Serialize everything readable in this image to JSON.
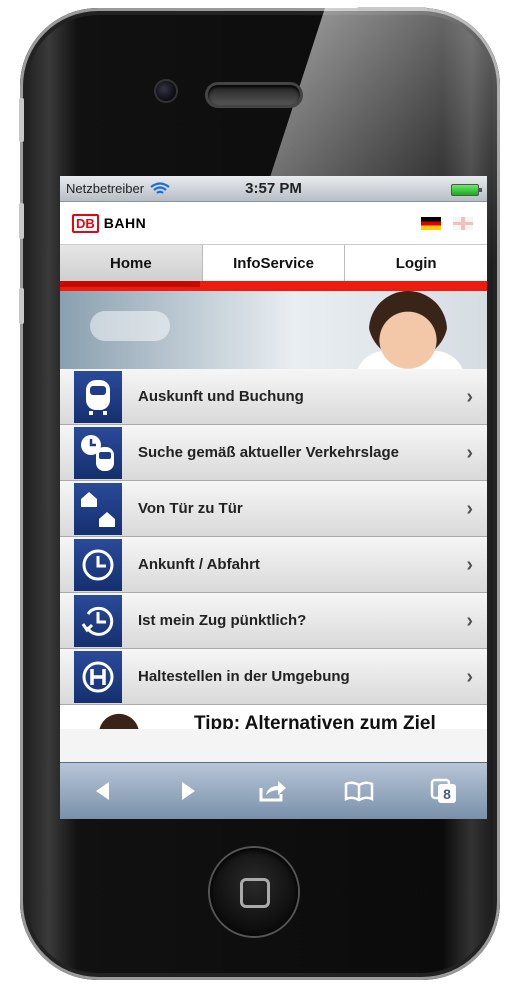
{
  "status_bar": {
    "carrier": "Netzbetreiber",
    "time": "3:57 PM"
  },
  "brand": {
    "logo_text": "DB",
    "name": "BAHN"
  },
  "tabs": [
    {
      "label": "Home"
    },
    {
      "label": "InfoService"
    },
    {
      "label": "Login"
    }
  ],
  "menu": [
    {
      "label": "Auskunft und Buchung",
      "icon": "train-icon"
    },
    {
      "label": "Suche gemäß aktueller Verkehrslage",
      "icon": "clock-train-icon"
    },
    {
      "label": "Von Tür zu Tür",
      "icon": "house-icon"
    },
    {
      "label": "Ankunft / Abfahrt",
      "icon": "clock-icon"
    },
    {
      "label": "Ist mein Zug pünktlich?",
      "icon": "clock-arrow-icon"
    },
    {
      "label": "Haltestellen in der Umgebung",
      "icon": "stop-h-icon"
    }
  ],
  "tipp": {
    "text": "Tipp: Alternativen zum Ziel"
  },
  "toolbar": {
    "tabs_count": "8"
  },
  "colors": {
    "db_red": "#e30613",
    "accent_red": "#ee1c0f",
    "icon_blue": "#1f3c86"
  }
}
